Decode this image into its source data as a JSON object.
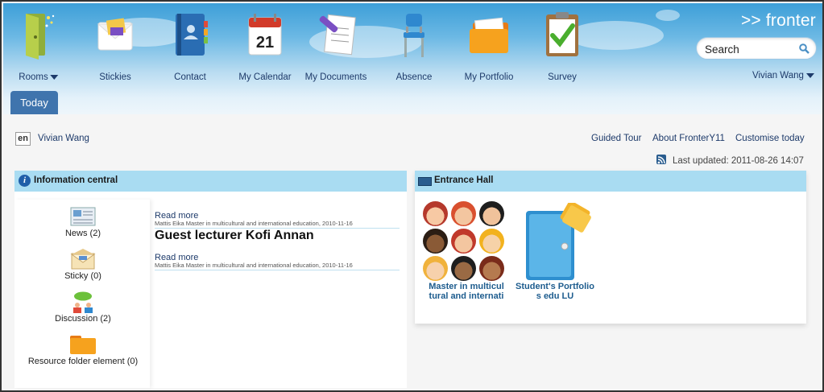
{
  "header": {
    "logo": ">> fronter",
    "nav": [
      {
        "label": "Rooms",
        "icon": "rooms-door-icon"
      },
      {
        "label": "Stickies",
        "icon": "stickies-envelope-icon"
      },
      {
        "label": "Contact",
        "icon": "contact-book-icon"
      },
      {
        "label": "My Calendar",
        "icon": "calendar-icon"
      },
      {
        "label": "My Documents",
        "icon": "documents-pen-icon"
      },
      {
        "label": "Absence",
        "icon": "chair-icon"
      },
      {
        "label": "My Portfolio",
        "icon": "portfolio-folder-icon"
      },
      {
        "label": "Survey",
        "icon": "survey-clipboard-icon"
      }
    ],
    "calendar_day": "21",
    "search": {
      "placeholder": "Search"
    },
    "user": "Vivian Wang"
  },
  "tabs": {
    "today": "Today"
  },
  "subbar": {
    "lang": "en",
    "user": "Vivian Wang",
    "guided_tour": "Guided Tour",
    "about": "About FronterY11",
    "customise": "Customise today",
    "last_updated": "Last updated: 2011-08-26 14:07"
  },
  "info_central": {
    "title": "Information central",
    "nav": [
      {
        "label": "News (2)",
        "icon": "news-icon"
      },
      {
        "label": "Sticky (0)",
        "icon": "sticky-envelope-icon"
      },
      {
        "label": "Discussion (2)",
        "icon": "discussion-icon"
      },
      {
        "label": "Resource folder element (0)",
        "icon": "folder-icon"
      }
    ],
    "items": [
      {
        "read_more": "Read more",
        "meta": "Mattis Eika Master in multicultural and international education, 2010-11-16"
      },
      {
        "headline": "Guest lecturer Kofi Annan",
        "read_more": "Read more",
        "meta": "Mattis Eika Master in multicultural and international education, 2010-11-16"
      }
    ]
  },
  "entrance_hall": {
    "title": "Entrance Hall",
    "rooms": [
      {
        "label_line1": "Master in multicul",
        "label_line2": "tural and internati"
      },
      {
        "label_line1": "Student's Portfolio",
        "label_line2": "s edu LU"
      }
    ]
  },
  "colors": {
    "header_blue": "#3d9fd8",
    "panel_head": "#a9dcf2",
    "tab": "#3f74ad",
    "link": "#1d3a6a"
  }
}
